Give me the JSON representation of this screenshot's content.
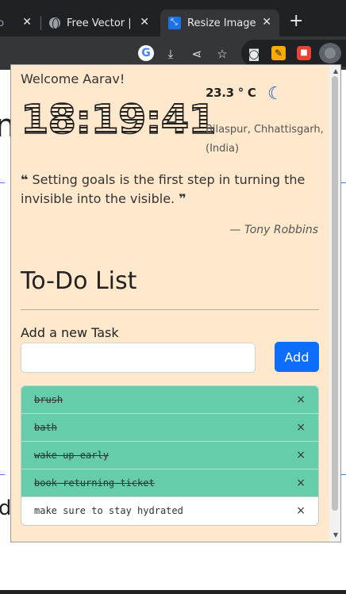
{
  "browser": {
    "tabs": [
      {
        "label": "Co",
        "active": false
      },
      {
        "label": "Free Vector |",
        "active": false
      },
      {
        "label": "Resize Image",
        "active": true
      }
    ],
    "close_glyph": "✕",
    "newtab_glyph": "+",
    "toolbar_icons": [
      "google-icon",
      "install-icon",
      "share-icon",
      "bookmark-star-icon",
      "camera-icon",
      "highlighter-icon",
      "extension-red-icon",
      "active-extension-icon"
    ]
  },
  "background_page": {
    "heading_fragment": "n",
    "subheading_fragment": "d"
  },
  "popup": {
    "welcome": "Welcome Aarav!",
    "time": "18:19:41",
    "temperature": "23.3 ° C",
    "weather_icon": "moon-icon",
    "location": "Bilaspur, Chhattisgarh, (India)",
    "quote": {
      "open_mark": "❝",
      "text": "Setting goals is the first step in turning the invisible into the visible.",
      "close_mark": "❞",
      "author_prefix": "—",
      "author": "Tony Robbins"
    },
    "todo": {
      "title": "To-Do List",
      "add_label": "Add a new Task",
      "input_value": "",
      "add_button": "Add",
      "remove_glyph": "×",
      "tasks": [
        {
          "text": "brush",
          "done": true
        },
        {
          "text": "bath",
          "done": true
        },
        {
          "text": "wake up early",
          "done": true
        },
        {
          "text": "book returning ticket",
          "done": true
        },
        {
          "text": "make sure to stay hydrated",
          "done": false
        }
      ]
    },
    "colors": {
      "background": "#ffe8cc",
      "done_task": "#66cdaa",
      "primary_button": "#0d6efd",
      "moon": "#1a55d8"
    }
  }
}
